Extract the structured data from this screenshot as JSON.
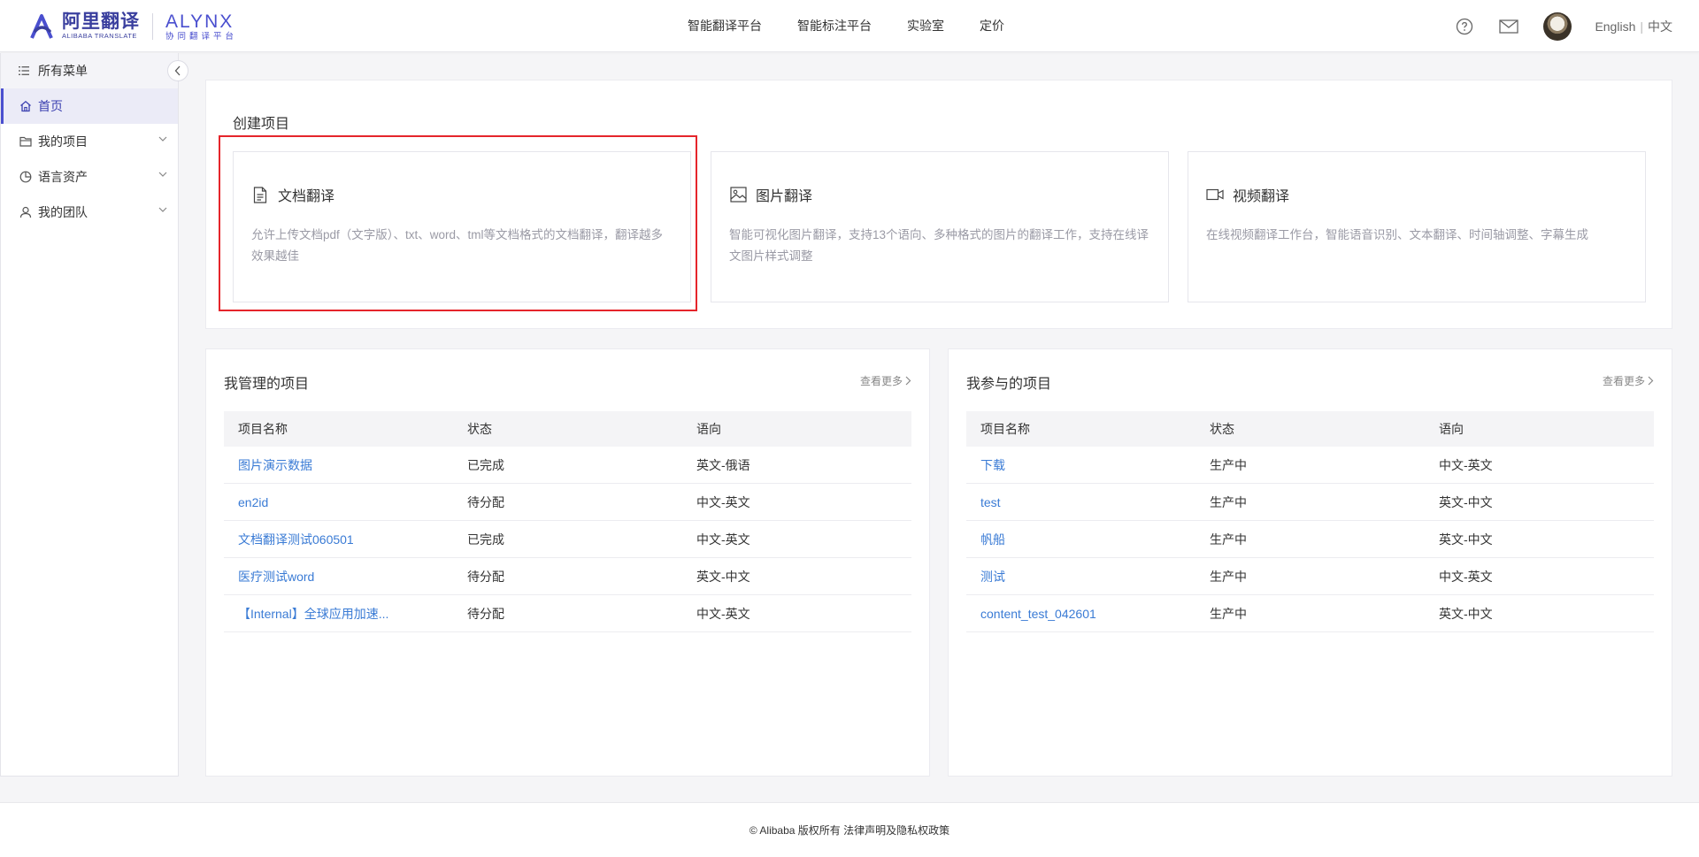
{
  "brand": {
    "name_cn": "阿里翻译",
    "name_en": "ALIBABA TRANSLATE",
    "product": "ALYNX",
    "product_sub": "协同翻译平台"
  },
  "topnav": [
    {
      "label": "智能翻译平台"
    },
    {
      "label": "智能标注平台"
    },
    {
      "label": "实验室"
    },
    {
      "label": "定价"
    }
  ],
  "header_right": {
    "help_icon": "question-circle-icon",
    "mail_icon": "mail-icon",
    "lang_en": "English",
    "lang_sep": "|",
    "lang_cn": "中文"
  },
  "sidebar": {
    "header": "所有菜单",
    "items": [
      {
        "label": "首页",
        "icon": "home-icon",
        "active": true
      },
      {
        "label": "我的项目",
        "icon": "folder-icon"
      },
      {
        "label": "语言资产",
        "icon": "pie-chart-icon"
      },
      {
        "label": "我的团队",
        "icon": "user-icon"
      }
    ]
  },
  "create": {
    "title": "创建项目",
    "cards": [
      {
        "title": "文档翻译",
        "desc": "允许上传文档pdf（文字版）、txt、word、tml等文档格式的文档翻译，翻译越多效果越佳"
      },
      {
        "title": "图片翻译",
        "desc": "智能可视化图片翻译，支持13个语向、多种格式的图片的翻译工作，支持在线译文图片样式调整"
      },
      {
        "title": "视频翻译",
        "desc": "在线视频翻译工作台，智能语音识别、文本翻译、时间轴调整、字幕生成"
      }
    ]
  },
  "managed": {
    "title": "我管理的项目",
    "more": "查看更多",
    "columns": [
      "项目名称",
      "状态",
      "语向"
    ],
    "rows": [
      {
        "name": "图片演示数据",
        "status": "已完成",
        "direction": "英文-俄语"
      },
      {
        "name": "en2id",
        "status": "待分配",
        "direction": "中文-英文"
      },
      {
        "name": "文档翻译测试060501",
        "status": "已完成",
        "direction": "中文-英文"
      },
      {
        "name": "医疗测试word",
        "status": "待分配",
        "direction": "英文-中文"
      },
      {
        "name": "【Internal】全球应用加速...",
        "status": "待分配",
        "direction": "中文-英文"
      }
    ]
  },
  "joined": {
    "title": "我参与的项目",
    "more": "查看更多",
    "columns": [
      "项目名称",
      "状态",
      "语向"
    ],
    "rows": [
      {
        "name": "下载",
        "status": "生产中",
        "direction": "中文-英文"
      },
      {
        "name": "test",
        "status": "生产中",
        "direction": "英文-中文"
      },
      {
        "name": "帆船",
        "status": "生产中",
        "direction": "英文-中文"
      },
      {
        "name": "测试",
        "status": "生产中",
        "direction": "中文-英文"
      },
      {
        "name": "content_test_042601",
        "status": "生产中",
        "direction": "英文-中文"
      }
    ]
  },
  "footer": {
    "text": "© Alibaba 版权所有 法律声明及隐私权政策"
  },
  "colors": {
    "brand": "#3a3f9e",
    "accent": "#4a4fcf",
    "link": "#3a7bd5",
    "highlight": "#e5252b"
  }
}
